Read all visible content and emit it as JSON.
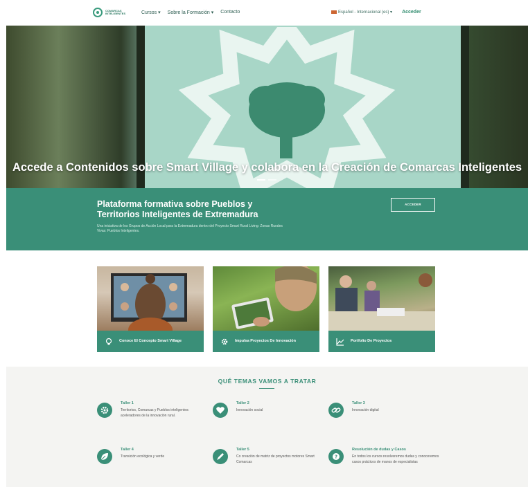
{
  "nav": {
    "logo_text": "COMARCAS INTELIGENTES",
    "links": [
      "Cursos",
      "Sobre la Formación",
      "Contacto"
    ],
    "language": "Español - Internacional (es)",
    "login": "Acceder"
  },
  "hero": {
    "title": "Accede a Contenidos sobre Smart Village y colabora en la Creación de Comarcas Inteligentes"
  },
  "banner": {
    "title": "Plataforma formativa sobre Pueblos y Territorios Inteligentes de Extremadura",
    "description": "Una iniciativa de los Grupos de Acción Local para la Extremadura dentro del Proyecto Smart Rural Living: Zonas Rurales Vivas: Pueblos Inteligentes.",
    "button": "ACCEDER"
  },
  "cards": [
    {
      "label": "Conoce El Concepto Smart Village",
      "icon": "lightbulb-icon"
    },
    {
      "label": "Impulsa Proyectos De Innovación",
      "icon": "gear-icon"
    },
    {
      "label": "Portfolio De Proyectos",
      "icon": "chart-line-icon"
    }
  ],
  "topics": {
    "heading": "QUÉ TEMAS VAMOS A TRATAR",
    "items": [
      {
        "title": "Taller 1",
        "desc": "Territorios, Comarcas y Pueblos inteligentes: aceleradores de la innovación rural.",
        "icon": "gear-icon"
      },
      {
        "title": "Taller 2",
        "desc": "Innovación social",
        "icon": "heart-icon"
      },
      {
        "title": "Taller 3",
        "desc": "Innovación digital",
        "icon": "link-icon"
      },
      {
        "title": "Taller 4",
        "desc": "Transición ecológica y verde",
        "icon": "leaf-icon"
      },
      {
        "title": "Taller 5",
        "desc": "Co creación de matriz de proyectos motores Smart Comarcas",
        "icon": "pen-icon"
      },
      {
        "title": "Resolución de dudas y Casos",
        "desc": "En todos los cursos resolveremos dudas y conoceremos casos prácticos de manos de especialistas",
        "icon": "question-icon"
      }
    ]
  },
  "colors": {
    "brand_green": "#3a8f78",
    "hero_light": "#a8d6c7",
    "section_bg": "#f4f4f2"
  }
}
